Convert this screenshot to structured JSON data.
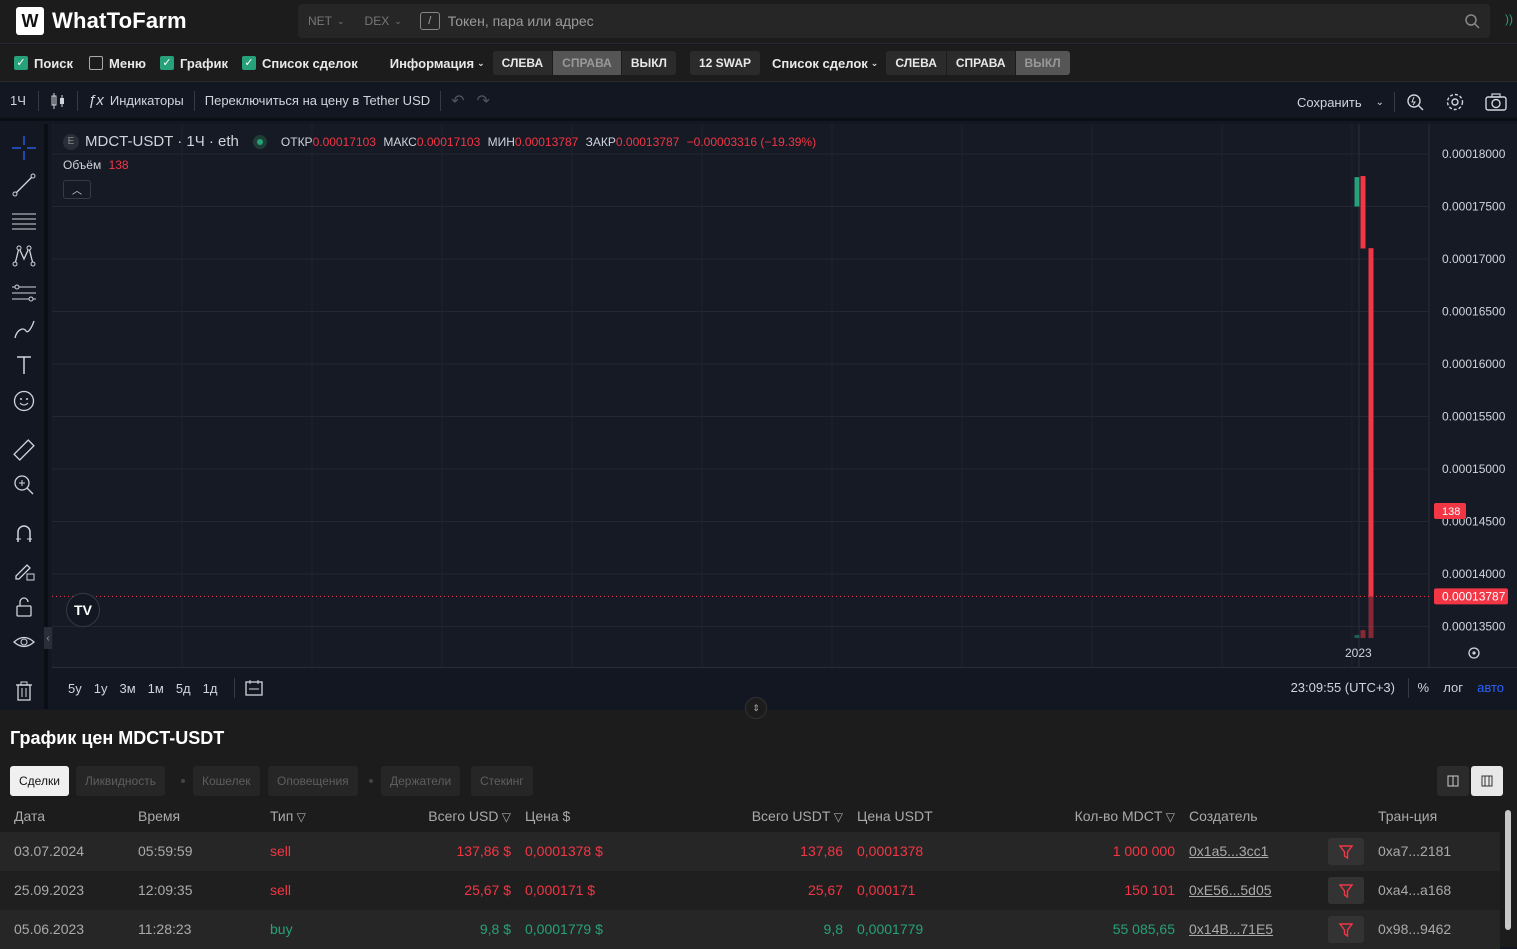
{
  "brand": {
    "name": "WhatToFarm",
    "mark": "W"
  },
  "search": {
    "net": "NET",
    "dex": "DEX",
    "placeholder": "Токен, пара или адрес"
  },
  "options": {
    "search": "Поиск",
    "menu": "Меню",
    "chart": "График",
    "deals": "Список сделок",
    "info": "Информация",
    "left": "СЛЕВА",
    "right": "СПРАВА",
    "off": "ВЫКЛ",
    "swap": "12 SWAP",
    "deals2": "Список сделок"
  },
  "toolbar": {
    "interval": "1Ч",
    "indicators": "Индикаторы",
    "switch": "Переключиться на цену в Tether USD",
    "save": "Сохранить"
  },
  "legend": {
    "ex": "E",
    "symbol": "MDCT-USDT · 1Ч · eth",
    "o_label": "ОТКР",
    "o": "0.00017103",
    "h_label": "МАКС",
    "h": "0.00017103",
    "l_label": "МИН",
    "l": "0.00013787",
    "c_label": "ЗАКР",
    "c": "0.00013787",
    "chg": "−0.00003316 (−19.39%)",
    "vol_label": "Объём",
    "vol": "138"
  },
  "chart_data": {
    "type": "candlestick",
    "y_axis": [
      "0.00018000",
      "0.00017500",
      "0.00017000",
      "0.00016500",
      "0.00016000",
      "0.00015500",
      "0.00015000",
      "0.00014500",
      "0.00014000",
      "0.00013500"
    ],
    "x_label": "2023",
    "volume_tag": "138",
    "price_tag": "0.00013787",
    "candles": [
      {
        "o": 0.000175,
        "c": 0.0001778,
        "h": 0.0001779,
        "l": 0.000175,
        "dir": "up"
      },
      {
        "o": 0.0001779,
        "c": 0.000171,
        "h": 0.0001779,
        "l": 0.000171,
        "dir": "down"
      },
      {
        "o": 0.00017103,
        "c": 0.00013787,
        "h": 0.00017103,
        "l": 0.00013787,
        "dir": "down"
      }
    ],
    "volumes": [
      {
        "v": 10,
        "dir": "up"
      },
      {
        "v": 26,
        "dir": "down"
      },
      {
        "v": 138,
        "dir": "down"
      }
    ],
    "y_min": 0.000133,
    "y_max": 0.000181
  },
  "ranges": [
    "5y",
    "1y",
    "3м",
    "1м",
    "5д",
    "1д"
  ],
  "timebar": {
    "time": "23:09:55 (UTC+3)",
    "pct": "%",
    "log": "лог",
    "auto": "авто"
  },
  "pane": {
    "title": "График цен MDCT-USDT",
    "tabs": [
      "Сделки",
      "Ликвидность",
      "Кошелек",
      "Оповещения",
      "Держатели",
      "Стекинг"
    ]
  },
  "table": {
    "headers": [
      "Дата",
      "Время",
      "Тип",
      "Всего USD",
      "Цена $",
      "Всего USDT",
      "Цена USDT",
      "Кол-во MDCT",
      "Создатель",
      "Тран-ция"
    ],
    "rows": [
      [
        "03.07.2024",
        "05:59:59",
        "sell",
        "137,86 $",
        "0,0001378 $",
        "137,86",
        "0,0001378",
        "1 000 000",
        "0x1a5...3cc1",
        "0xa7...2181"
      ],
      [
        "25.09.2023",
        "12:09:35",
        "sell",
        "25,67 $",
        "0,000171 $",
        "25,67",
        "0,000171",
        "150 101",
        "0xE56...5d05",
        "0xa4...a168"
      ],
      [
        "05.06.2023",
        "11:28:23",
        "buy",
        "9,8 $",
        "0,0001779 $",
        "9,8",
        "0,0001779",
        "55 085,65",
        "0x14B...71E5",
        "0x98...9462"
      ]
    ]
  }
}
